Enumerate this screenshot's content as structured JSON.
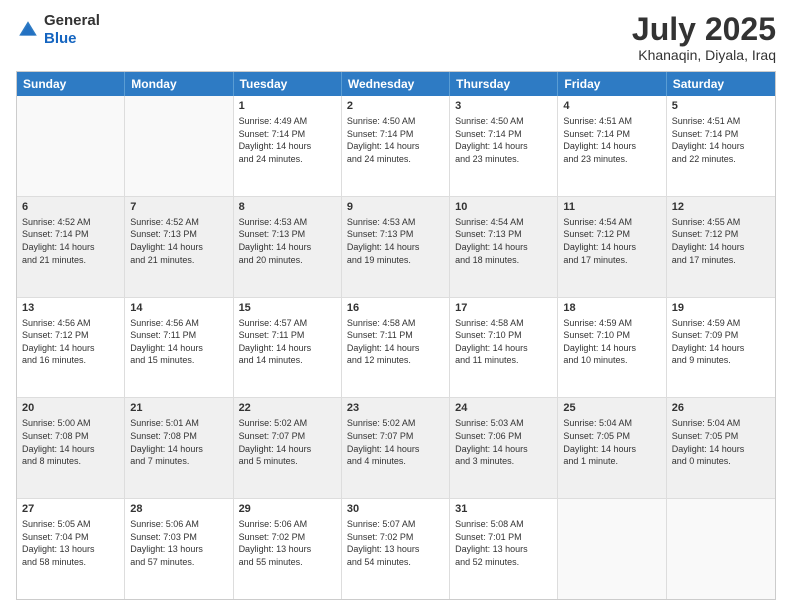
{
  "header": {
    "logo_line1": "General",
    "logo_line2": "Blue",
    "main_title": "July 2025",
    "subtitle": "Khanaqin, Diyala, Iraq"
  },
  "calendar": {
    "days_of_week": [
      "Sunday",
      "Monday",
      "Tuesday",
      "Wednesday",
      "Thursday",
      "Friday",
      "Saturday"
    ],
    "weeks": [
      {
        "cells": [
          {
            "day": "",
            "text": "",
            "empty": true
          },
          {
            "day": "",
            "text": "",
            "empty": true
          },
          {
            "day": "1",
            "text": "Sunrise: 4:49 AM\nSunset: 7:14 PM\nDaylight: 14 hours\nand 24 minutes.",
            "shaded": false
          },
          {
            "day": "2",
            "text": "Sunrise: 4:50 AM\nSunset: 7:14 PM\nDaylight: 14 hours\nand 24 minutes.",
            "shaded": false
          },
          {
            "day": "3",
            "text": "Sunrise: 4:50 AM\nSunset: 7:14 PM\nDaylight: 14 hours\nand 23 minutes.",
            "shaded": false
          },
          {
            "day": "4",
            "text": "Sunrise: 4:51 AM\nSunset: 7:14 PM\nDaylight: 14 hours\nand 23 minutes.",
            "shaded": false
          },
          {
            "day": "5",
            "text": "Sunrise: 4:51 AM\nSunset: 7:14 PM\nDaylight: 14 hours\nand 22 minutes.",
            "shaded": false
          }
        ]
      },
      {
        "cells": [
          {
            "day": "6",
            "text": "Sunrise: 4:52 AM\nSunset: 7:14 PM\nDaylight: 14 hours\nand 21 minutes.",
            "shaded": true
          },
          {
            "day": "7",
            "text": "Sunrise: 4:52 AM\nSunset: 7:13 PM\nDaylight: 14 hours\nand 21 minutes.",
            "shaded": true
          },
          {
            "day": "8",
            "text": "Sunrise: 4:53 AM\nSunset: 7:13 PM\nDaylight: 14 hours\nand 20 minutes.",
            "shaded": true
          },
          {
            "day": "9",
            "text": "Sunrise: 4:53 AM\nSunset: 7:13 PM\nDaylight: 14 hours\nand 19 minutes.",
            "shaded": true
          },
          {
            "day": "10",
            "text": "Sunrise: 4:54 AM\nSunset: 7:13 PM\nDaylight: 14 hours\nand 18 minutes.",
            "shaded": true
          },
          {
            "day": "11",
            "text": "Sunrise: 4:54 AM\nSunset: 7:12 PM\nDaylight: 14 hours\nand 17 minutes.",
            "shaded": true
          },
          {
            "day": "12",
            "text": "Sunrise: 4:55 AM\nSunset: 7:12 PM\nDaylight: 14 hours\nand 17 minutes.",
            "shaded": true
          }
        ]
      },
      {
        "cells": [
          {
            "day": "13",
            "text": "Sunrise: 4:56 AM\nSunset: 7:12 PM\nDaylight: 14 hours\nand 16 minutes.",
            "shaded": false
          },
          {
            "day": "14",
            "text": "Sunrise: 4:56 AM\nSunset: 7:11 PM\nDaylight: 14 hours\nand 15 minutes.",
            "shaded": false
          },
          {
            "day": "15",
            "text": "Sunrise: 4:57 AM\nSunset: 7:11 PM\nDaylight: 14 hours\nand 14 minutes.",
            "shaded": false
          },
          {
            "day": "16",
            "text": "Sunrise: 4:58 AM\nSunset: 7:11 PM\nDaylight: 14 hours\nand 12 minutes.",
            "shaded": false
          },
          {
            "day": "17",
            "text": "Sunrise: 4:58 AM\nSunset: 7:10 PM\nDaylight: 14 hours\nand 11 minutes.",
            "shaded": false
          },
          {
            "day": "18",
            "text": "Sunrise: 4:59 AM\nSunset: 7:10 PM\nDaylight: 14 hours\nand 10 minutes.",
            "shaded": false
          },
          {
            "day": "19",
            "text": "Sunrise: 4:59 AM\nSunset: 7:09 PM\nDaylight: 14 hours\nand 9 minutes.",
            "shaded": false
          }
        ]
      },
      {
        "cells": [
          {
            "day": "20",
            "text": "Sunrise: 5:00 AM\nSunset: 7:08 PM\nDaylight: 14 hours\nand 8 minutes.",
            "shaded": true
          },
          {
            "day": "21",
            "text": "Sunrise: 5:01 AM\nSunset: 7:08 PM\nDaylight: 14 hours\nand 7 minutes.",
            "shaded": true
          },
          {
            "day": "22",
            "text": "Sunrise: 5:02 AM\nSunset: 7:07 PM\nDaylight: 14 hours\nand 5 minutes.",
            "shaded": true
          },
          {
            "day": "23",
            "text": "Sunrise: 5:02 AM\nSunset: 7:07 PM\nDaylight: 14 hours\nand 4 minutes.",
            "shaded": true
          },
          {
            "day": "24",
            "text": "Sunrise: 5:03 AM\nSunset: 7:06 PM\nDaylight: 14 hours\nand 3 minutes.",
            "shaded": true
          },
          {
            "day": "25",
            "text": "Sunrise: 5:04 AM\nSunset: 7:05 PM\nDaylight: 14 hours\nand 1 minute.",
            "shaded": true
          },
          {
            "day": "26",
            "text": "Sunrise: 5:04 AM\nSunset: 7:05 PM\nDaylight: 14 hours\nand 0 minutes.",
            "shaded": true
          }
        ]
      },
      {
        "cells": [
          {
            "day": "27",
            "text": "Sunrise: 5:05 AM\nSunset: 7:04 PM\nDaylight: 13 hours\nand 58 minutes.",
            "shaded": false
          },
          {
            "day": "28",
            "text": "Sunrise: 5:06 AM\nSunset: 7:03 PM\nDaylight: 13 hours\nand 57 minutes.",
            "shaded": false
          },
          {
            "day": "29",
            "text": "Sunrise: 5:06 AM\nSunset: 7:02 PM\nDaylight: 13 hours\nand 55 minutes.",
            "shaded": false
          },
          {
            "day": "30",
            "text": "Sunrise: 5:07 AM\nSunset: 7:02 PM\nDaylight: 13 hours\nand 54 minutes.",
            "shaded": false
          },
          {
            "day": "31",
            "text": "Sunrise: 5:08 AM\nSunset: 7:01 PM\nDaylight: 13 hours\nand 52 minutes.",
            "shaded": false
          },
          {
            "day": "",
            "text": "",
            "empty": true
          },
          {
            "day": "",
            "text": "",
            "empty": true
          }
        ]
      }
    ]
  }
}
